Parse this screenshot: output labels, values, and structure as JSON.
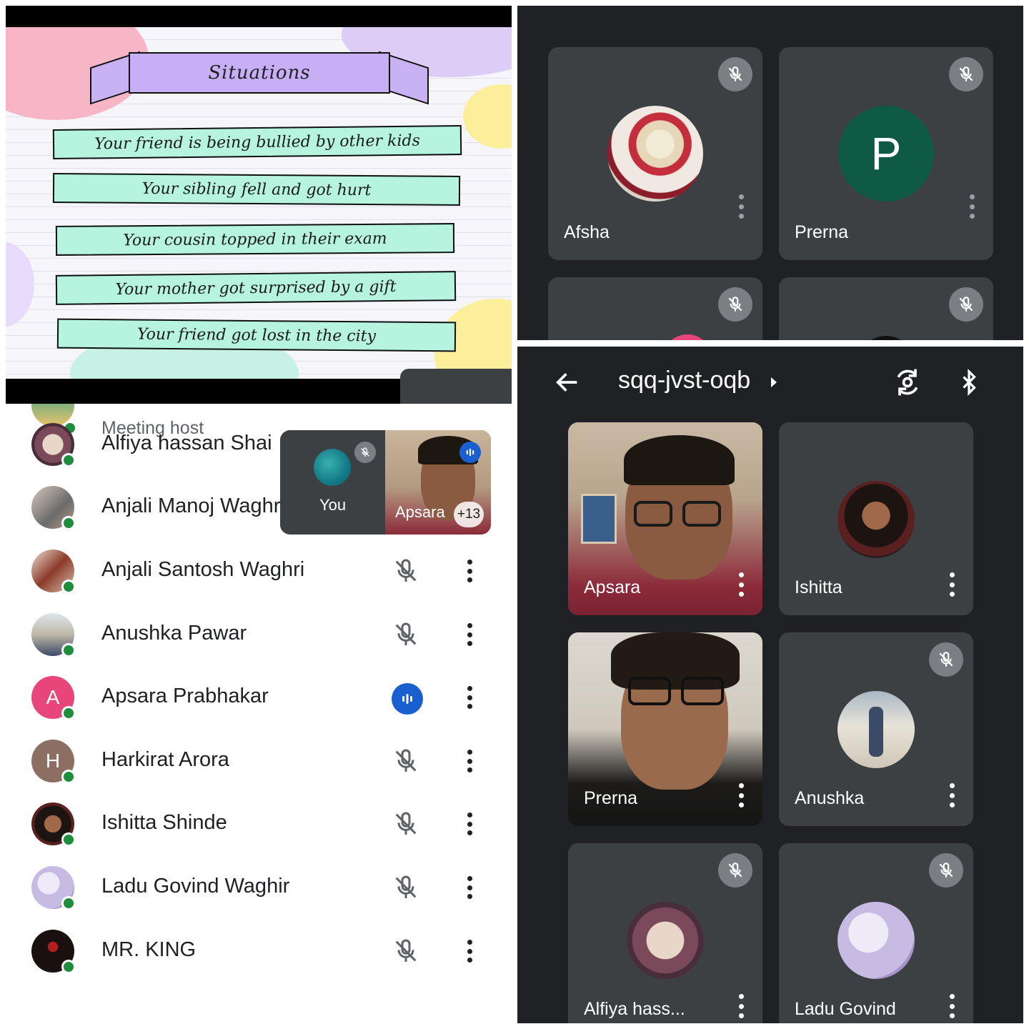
{
  "slide": {
    "title": "Situations",
    "items": [
      "Your friend is being bullied by other kids",
      "Your sibling fell and got hurt",
      "Your cousin topped in their exam",
      "Your mother got surprised by a gift",
      "Your friend got lost in the city"
    ]
  },
  "top_grid": {
    "tiles": [
      {
        "name": "Afsha",
        "muted": true
      },
      {
        "name": "Prerna",
        "initial": "P",
        "muted": true
      }
    ]
  },
  "call_header": {
    "meeting_code": "sqq-jvst-oqb"
  },
  "video_grid": {
    "tiles": [
      {
        "name": "Apsara",
        "muted": false
      },
      {
        "name": "Ishitta",
        "muted": false
      },
      {
        "name": "Prerna",
        "muted": false
      },
      {
        "name": "Anushka",
        "muted": true
      },
      {
        "name": "Alfiya hass...",
        "muted": true
      },
      {
        "name": "Ladu Govind",
        "muted": true
      }
    ]
  },
  "participants": {
    "host_label": "Meeting host",
    "list": [
      {
        "name": "Alfiya hassan Shai",
        "muted": true
      },
      {
        "name": "Anjali Manoj Waghri",
        "muted": true
      },
      {
        "name": "Anjali Santosh Waghri",
        "muted": true
      },
      {
        "name": "Anushka Pawar",
        "muted": true
      },
      {
        "name": "Apsara Prabhakar",
        "initial": "A",
        "speaking": true
      },
      {
        "name": "Harkirat Arora",
        "initial": "H",
        "muted": true
      },
      {
        "name": "Ishitta Shinde",
        "muted": true
      },
      {
        "name": "Ladu Govind Waghir",
        "muted": true
      },
      {
        "name": "MR. KING",
        "muted": true
      }
    ]
  },
  "self_view": {
    "you_label": "You",
    "speaker_name": "Apsara",
    "extra_count": "+13"
  },
  "colors": {
    "dark_bg": "#202124",
    "tile_bg": "#3c4043",
    "online_dot": "#1e8e3e",
    "speaking_blue": "#1a5fd0",
    "avatar_prerna": "#0f5a43",
    "avatar_apsara": "#e8457a",
    "avatar_harkirat": "#8d6e63"
  },
  "icons": [
    "back-arrow-icon",
    "chevron-right-icon",
    "switch-camera-icon",
    "bluetooth-icon",
    "mic-off-icon",
    "more-vert-icon",
    "speaking-icon"
  ]
}
